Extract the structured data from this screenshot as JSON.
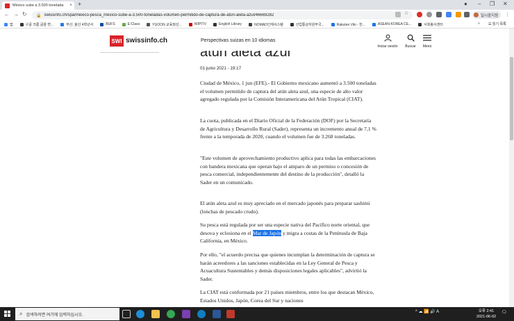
{
  "browser": {
    "tab_title": "México sube a 3.500 tonelada",
    "tab_close": "×",
    "new_tab": "+",
    "url": "swissinfo.ch/spa/méxico-pesca_méxico-sube-a-3.500-toneladas-volumen-permitido-de-captura-de-atún-aleta-azul/46669282",
    "profile_label": "일시중지됨",
    "bookmarks": [
      "앱",
      "구글 크롬 글꼴 변...",
      "부산, 울산 4학년서",
      "BUFS",
      "E-Class",
      "YGOON 교육정산...",
      "WIPITV",
      "English Library",
      "NOMAD인재서스템",
      "산업통상자원부국...",
      "Rakuten Viki - 한...",
      "ASEAN-KOREA CE...",
      "사회봉사센터"
    ],
    "bookmarks_overflow": "»",
    "reading_list": "읽기 목록"
  },
  "site": {
    "logo_box": "SWI",
    "logo_text": "swissinfo.ch",
    "tagline": "Perspectivas suizas en 10 idiomas",
    "actions": [
      {
        "label": "Iniciar sesión",
        "icon": "user-icon"
      },
      {
        "label": "Buscar",
        "icon": "search-icon"
      },
      {
        "label": "Menú",
        "icon": "menu-icon"
      }
    ]
  },
  "article": {
    "title_fragment": "atún aleta azul",
    "date": "01 junio 2021 - 19:17",
    "p1": "Ciudad de México, 1 jun (EFE).- El Gobierno mexicano aumentó a 3.500 toneladas el volumen permitido de captura del atún aleta azul, una especie de alto valor agregado regulada por la Comisión Interamericana del Atún Tropical (CIAT).",
    "p2": "La cuota, publicada en el Diario Oficial de la Federación (DOF) por la Secretaría de Agricultura y Desarrollo Rural (Sader), representa un incremento anual de 7,1 % frente a la temporada de 2020, cuando el volumen fue de 3.268 toneladas.",
    "p3": "\"Este volumen de aprovechamiento productivo aplica para todas las embarcaciones con bandera mexicana que operan bajo el amparo de un permiso o concesión de pesca comercial, independientemente del destino de la producción\", detalló la Sader en un comunicado.",
    "p4": "El atún aleta azul es muy apreciado en el mercado japonés para preparar sashimi (lonchas de pescado crudo).",
    "p5_before": "Su pesca está regulada por ser una especie nativa del Pacífico norte oriental, que desova y eclosiona en el ",
    "p5_highlight": "Mar de Japón",
    "p5_after": " y migra a costas de la Península de Baja California, en México.",
    "p6": "Por ello, \"el acuerdo precisa que quienes incumplan la determinación de captura se harán acreedores a las sanciones establecidas en la Ley General de Pesca y Acuacultura Sustentables y demás disposiciones legales aplicables\", advirtió la Sader.",
    "p7": "La CIAT está conformada por 21 países miembros, entre los que destacan México, Estados Unidos, Japón, Corea del Sur y naciones"
  },
  "taskbar": {
    "search_placeholder": "검색하려면 여기에 입력하십시오.",
    "time": "오후 2:41",
    "date": "2021-06-02",
    "tray_text": "^ ☁ 📶 🔊 A"
  },
  "colors": {
    "brand_red": "#d8232a",
    "highlight": "#1a73e8"
  }
}
